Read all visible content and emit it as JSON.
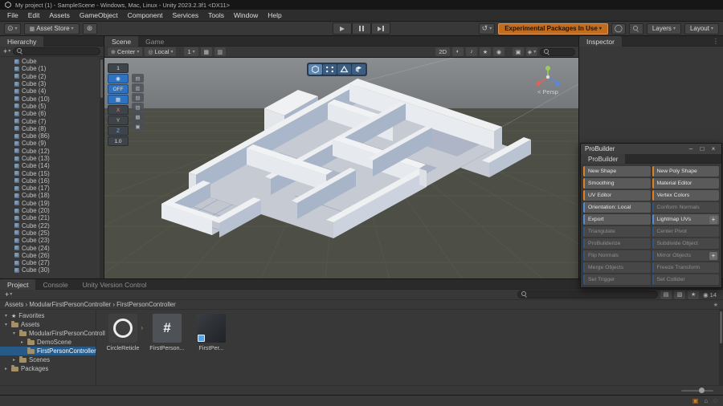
{
  "title_bar": {
    "title": "My project (1) - SampleScene - Windows, Mac, Linux - Unity 2023.2.3f1 <DX11>"
  },
  "menu": {
    "items": [
      "File",
      "Edit",
      "Assets",
      "GameObject",
      "Component",
      "Services",
      "Tools",
      "Window",
      "Help"
    ]
  },
  "toolbar": {
    "asset_store_label": "Asset Store",
    "experimental_label": "Experimental Packages In Use",
    "layers_label": "Layers",
    "layout_label": "Layout"
  },
  "hierarchy": {
    "tab": "Hierarchy",
    "items": [
      "Cube",
      "Cube (1)",
      "Cube (2)",
      "Cube (3)",
      "Cube (4)",
      "Cube (10)",
      "Cube (5)",
      "Cube (6)",
      "Cube (7)",
      "Cube (8)",
      "Cube (86)",
      "Cube (9)",
      "Cube (12)",
      "Cube (13)",
      "Cube (14)",
      "Cube (15)",
      "Cube (16)",
      "Cube (17)",
      "Cube (18)",
      "Cube (19)",
      "Cube (20)",
      "Cube (21)",
      "Cube (22)",
      "Cube (25)",
      "Cube (23)",
      "Cube (24)",
      "Cube (26)",
      "Cube (27)",
      "Cube (30)"
    ]
  },
  "scene_view": {
    "tabs": [
      {
        "label": "Scene",
        "classes": "active"
      },
      {
        "label": "Game",
        "classes": ""
      }
    ],
    "pivot_label": "Center",
    "orientation_label": "Local",
    "grid_value": "1",
    "two_d_label": "2D",
    "persp_caret": "<",
    "persp_label": "Persp",
    "progrids": [
      {
        "label": "1",
        "classes": "dark"
      },
      {
        "label": "◉",
        "classes": "blue"
      },
      {
        "label": "OFF",
        "classes": "blue"
      },
      {
        "label": "▦",
        "classes": "blue"
      },
      {
        "label": "X",
        "classes": "dark ax-x"
      },
      {
        "label": "Y",
        "classes": "dark ax-y"
      },
      {
        "label": "Z",
        "classes": "dark ax-z"
      },
      {
        "label": "1.0",
        "classes": "dark"
      }
    ],
    "progrids_mini": [
      {
        "label": "▤",
        "classes": ""
      },
      {
        "label": "▥",
        "classes": ""
      },
      {
        "label": "▧",
        "classes": ""
      },
      {
        "label": "▨",
        "classes": ""
      },
      {
        "label": "▩",
        "classes": ""
      },
      {
        "label": "▣",
        "classes": ""
      }
    ]
  },
  "inspector": {
    "tab": "Inspector"
  },
  "probuilder": {
    "window_title": "ProBuilder",
    "tab": "ProBuilder",
    "buttons": [
      {
        "label": "New Shape",
        "classes": "orange"
      },
      {
        "label": "New Poly Shape",
        "classes": "orange"
      },
      {
        "label": "Smoothing",
        "classes": "orange"
      },
      {
        "label": "Material Editor",
        "classes": "orange"
      },
      {
        "label": "UV Editor",
        "classes": "orange"
      },
      {
        "label": "Vertex Colors",
        "classes": "orange"
      },
      {
        "label": "Orientation: Local",
        "classes": "blue"
      },
      {
        "label": "Conform Normals",
        "classes": "blue disabled"
      },
      {
        "label": "Export",
        "classes": "blue"
      },
      {
        "label": "Lightmap UVs",
        "classes": "blue has-plus"
      },
      {
        "label": "Triangulate",
        "classes": "blue disabled"
      },
      {
        "label": "Center Pivot",
        "classes": "blue disabled"
      },
      {
        "label": "ProBuilderize",
        "classes": "blue disabled"
      },
      {
        "label": "Subdivide Object",
        "classes": "blue disabled"
      },
      {
        "label": "Flip Normals",
        "classes": "blue disabled"
      },
      {
        "label": "Mirror Objects",
        "classes": "blue disabled has-plus"
      },
      {
        "label": "Merge Objects",
        "classes": "blue disabled"
      },
      {
        "label": "Freeze Transform",
        "classes": "blue disabled"
      },
      {
        "label": "Set Trigger",
        "classes": "blue disabled"
      },
      {
        "label": "Set Collider",
        "classes": "blue disabled"
      }
    ]
  },
  "project": {
    "tabs": [
      {
        "label": "Project",
        "classes": "active"
      },
      {
        "label": "Console",
        "classes": ""
      },
      {
        "label": "Unity Version Control",
        "classes": ""
      }
    ],
    "breadcrumb": "Assets › ModularFirstPersonController › FirstPersonController",
    "count_badge": "14",
    "tree": [
      {
        "caret": "▾",
        "label": "Favorites",
        "classes": "root star"
      },
      {
        "caret": "▾",
        "label": "Assets",
        "classes": "root"
      },
      {
        "caret": "▾",
        "label": "ModularFirstPersonControll",
        "classes": "d1"
      },
      {
        "caret": "▸",
        "label": "DemoScene",
        "classes": "d2"
      },
      {
        "caret": "",
        "label": "FirstPersonController",
        "classes": "d2 selected"
      },
      {
        "caret": "▸",
        "label": "Scenes",
        "classes": "d1"
      },
      {
        "caret": "▸",
        "label": "Packages",
        "classes": "root"
      }
    ],
    "assets": [
      {
        "label": "CircleReticle",
        "classes": "reticle"
      },
      {
        "label": "FirstPerson...",
        "classes": "script"
      },
      {
        "label": "FirstPer...",
        "classes": "prefab"
      }
    ],
    "script_hash": "#"
  },
  "icons": {
    "caret": "▾",
    "plus": "+",
    "dots": "⋮",
    "expander": "›",
    "star": "★",
    "minimize": "–",
    "maximize": "□",
    "close": "×",
    "account": "⊙",
    "store": "▦",
    "gear": "⊛",
    "undo": "↺",
    "cloud": "◯",
    "pivot": "⊕",
    "orientation": "◎",
    "grid": "▦",
    "magnet": "▥",
    "lighting": "◐",
    "audio": "♪",
    "effects": "★",
    "visibility": "◉",
    "camera": "▣",
    "gizmos": "◈",
    "search_type": "▤",
    "search_label": "▧",
    "status_a": "▣",
    "status_b": "⌂",
    "status_c": "◌"
  }
}
